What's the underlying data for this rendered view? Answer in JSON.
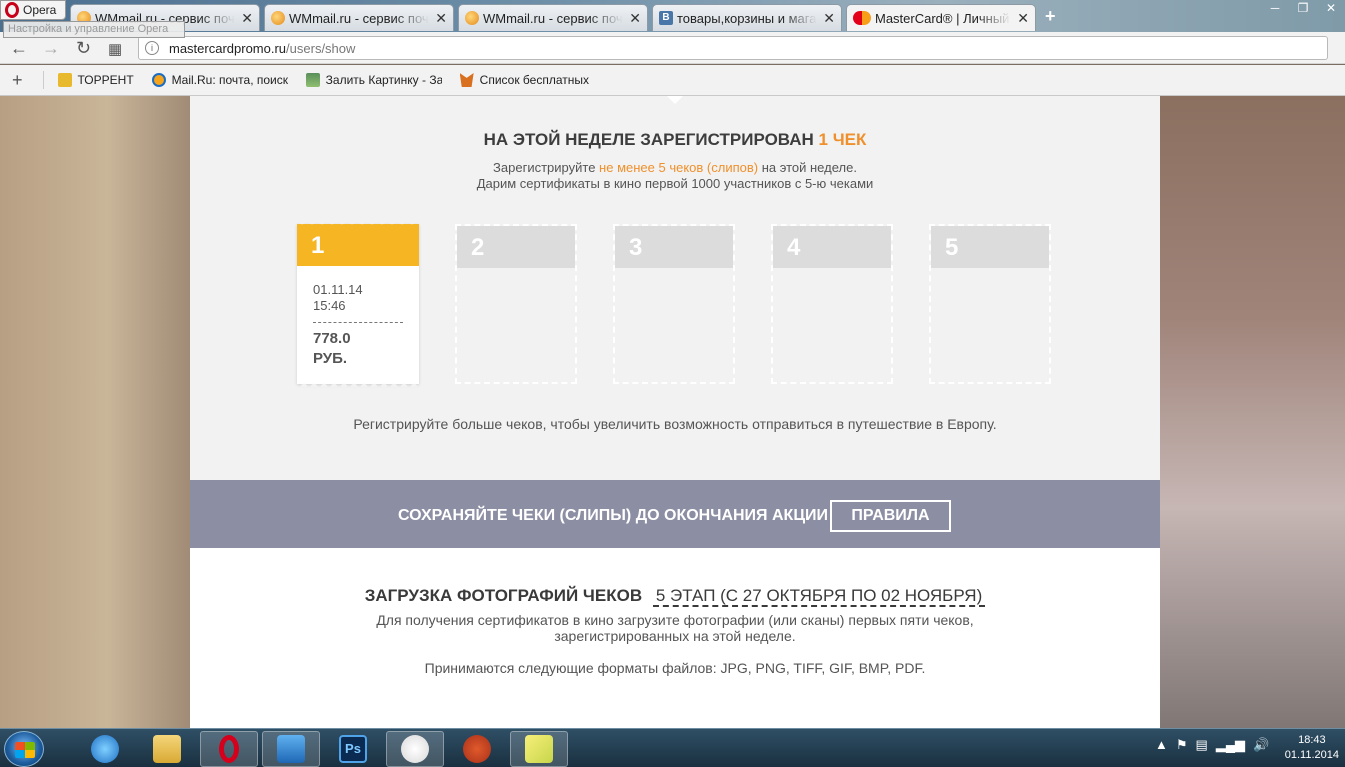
{
  "browser": {
    "menu_label": "Opera",
    "menu_tooltip": "Настройка и управление Opera",
    "tabs": [
      {
        "title": "WMmail.ru - сервис почтовых рассылок",
        "favicon": "wmmail-icon"
      },
      {
        "title": "WMmail.ru - сервис почтовых рассылок",
        "favicon": "wmmail-icon"
      },
      {
        "title": "WMmail.ru - сервис почтовых рассылок",
        "favicon": "wmmail-icon"
      },
      {
        "title": "товары,корзины и магазины",
        "favicon": "vk-icon"
      },
      {
        "title": "MasterCard® | Личный кабинет",
        "favicon": "mastercard-icon"
      }
    ],
    "tab_close": "✕",
    "new_tab": "+",
    "window_controls": [
      "─",
      "❐",
      "✕"
    ],
    "url_host": "mastercardpromo.ru",
    "url_path": "/users/show",
    "bookmarks": [
      {
        "label": "ТОРРЕНТ",
        "icon": "folder-icon"
      },
      {
        "label": "Mail.Ru: почта, поиск в интернете",
        "icon": "mailru-icon"
      },
      {
        "label": "Залить Картинку - Залить фото",
        "icon": "image-upload-icon"
      },
      {
        "label": "Список бесплатных",
        "icon": "fox-icon"
      }
    ]
  },
  "week": {
    "title_prefix": "НА ЭТОЙ НЕДЕЛЕ ЗАРЕГИСТРИРОВАН",
    "title_count": "1 ЧЕК",
    "sub_prefix": "Зарегистрируйте",
    "sub_highlight": "не менее 5 чеков (слипов)",
    "sub_suffix": "на этой неделе.",
    "sub_line2": "Дарим сертификаты в кино первой 1000 участников с 5-ю чеками"
  },
  "tickets": [
    {
      "number": "1",
      "date": "01.11.14",
      "time": "15:46",
      "amount": "778.0",
      "currency": "РУБ."
    },
    {
      "number": "2"
    },
    {
      "number": "3"
    },
    {
      "number": "4"
    },
    {
      "number": "5"
    }
  ],
  "more_text": "Регистрируйте больше чеков, чтобы увеличить возможность отправиться в путешествие в Европу.",
  "keep": {
    "text": "СОХРАНЯЙТЕ ЧЕКИ (СЛИПЫ) ДО ОКОНЧАНИЯ АКЦИИ",
    "rules_button": "ПРАВИЛА"
  },
  "upload": {
    "title": "ЗАГРУЗКА ФОТОГРАФИЙ ЧЕКОВ",
    "stage": "5 ЭТАП (С 27 ОКТЯБРЯ ПО 02 НОЯБРЯ)",
    "desc_line1": "Для получения сертификатов в кино загрузите фотографии (или сканы) первых пяти чеков,",
    "desc_line2": "зарегистрированных на этой неделе.",
    "formats": "Принимаются следующие форматы файлов: JPG, PNG, TIFF, GIF, BMP, PDF."
  },
  "colors": {
    "accent": "#f0902c",
    "ticket_filled": "#f6b623",
    "keep_bar": "#8c8ea3"
  },
  "taskbar": {
    "apps": [
      "internet-explorer-icon",
      "file-explorer-icon",
      "opera-icon",
      "media-player-icon",
      "photoshop-icon",
      "paint-icon",
      "ccleaner-icon",
      "sticky-notes-icon"
    ],
    "time": "18:43",
    "date": "01.11.2014"
  }
}
